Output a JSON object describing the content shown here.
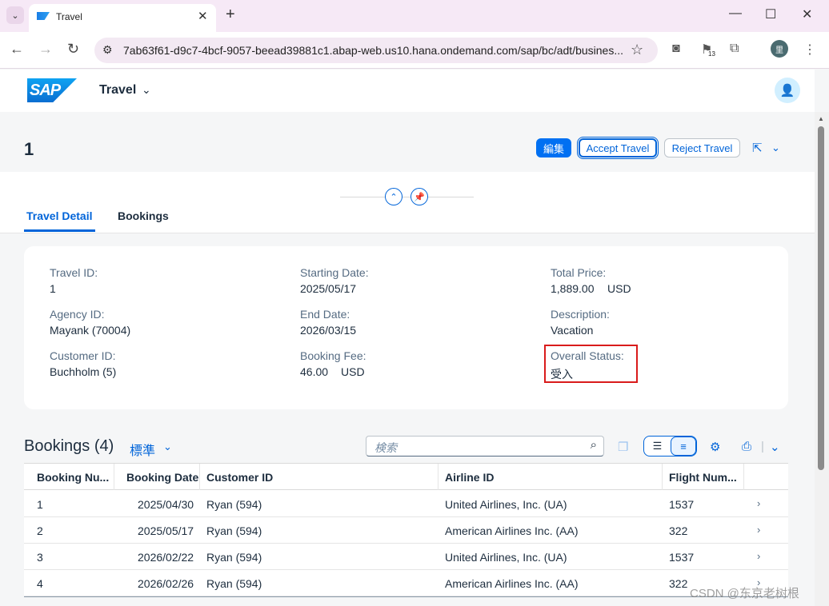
{
  "browser": {
    "tab_title": "Travel",
    "tab_close": "✕",
    "new_tab": "+",
    "url": "7ab63f61-d9c7-4bcf-9057-beead39881c1.abap-web.us10.hana.ondemand.com/sap/bc/adt/busines...",
    "ext_badge": "13",
    "profile_initial": "里"
  },
  "shell": {
    "logo_text": "SAP",
    "app_title": "Travel"
  },
  "header": {
    "object_title": "1",
    "edit_label": "編集",
    "accept_label": "Accept Travel",
    "reject_label": "Reject Travel"
  },
  "tabs": [
    {
      "label": "Travel Detail",
      "active": true
    },
    {
      "label": "Bookings",
      "active": false
    }
  ],
  "details": {
    "travel_id_label": "Travel ID:",
    "travel_id": "1",
    "agency_id_label": "Agency ID:",
    "agency_id": "Mayank (70004)",
    "customer_id_label": "Customer ID:",
    "customer_id": "Buchholm (5)",
    "starting_date_label": "Starting Date:",
    "starting_date": "2025/05/17",
    "end_date_label": "End Date:",
    "end_date": "2026/03/15",
    "booking_fee_label": "Booking Fee:",
    "booking_fee": "46.00",
    "booking_fee_currency": "USD",
    "total_price_label": "Total Price:",
    "total_price": "1,889.00",
    "total_price_currency": "USD",
    "description_label": "Description:",
    "description": "Vacation",
    "overall_status_label": "Overall Status:",
    "overall_status": "受入"
  },
  "bookings": {
    "title": "Bookings (4)",
    "variant": "標準",
    "search_placeholder": "検索",
    "columns": [
      "Booking Nu...",
      "Booking Date",
      "Customer ID",
      "Airline ID",
      "Flight Num..."
    ],
    "rows": [
      {
        "number": "1",
        "date": "2025/04/30",
        "customer": "Ryan (594)",
        "airline": "United Airlines, Inc. (UA)",
        "flight": "1537"
      },
      {
        "number": "2",
        "date": "2025/05/17",
        "customer": "Ryan (594)",
        "airline": "American Airlines Inc. (AA)",
        "flight": "322"
      },
      {
        "number": "3",
        "date": "2026/02/22",
        "customer": "Ryan (594)",
        "airline": "United Airlines, Inc. (UA)",
        "flight": "1537"
      },
      {
        "number": "4",
        "date": "2026/02/26",
        "customer": "Ryan (594)",
        "airline": "American Airlines Inc. (AA)",
        "flight": "322"
      }
    ]
  },
  "watermark": "CSDN @东京老树根",
  "colors": {
    "accent": "#0064d9",
    "emphasized_button": "#0070f2",
    "highlight_border": "#d91b1b"
  }
}
